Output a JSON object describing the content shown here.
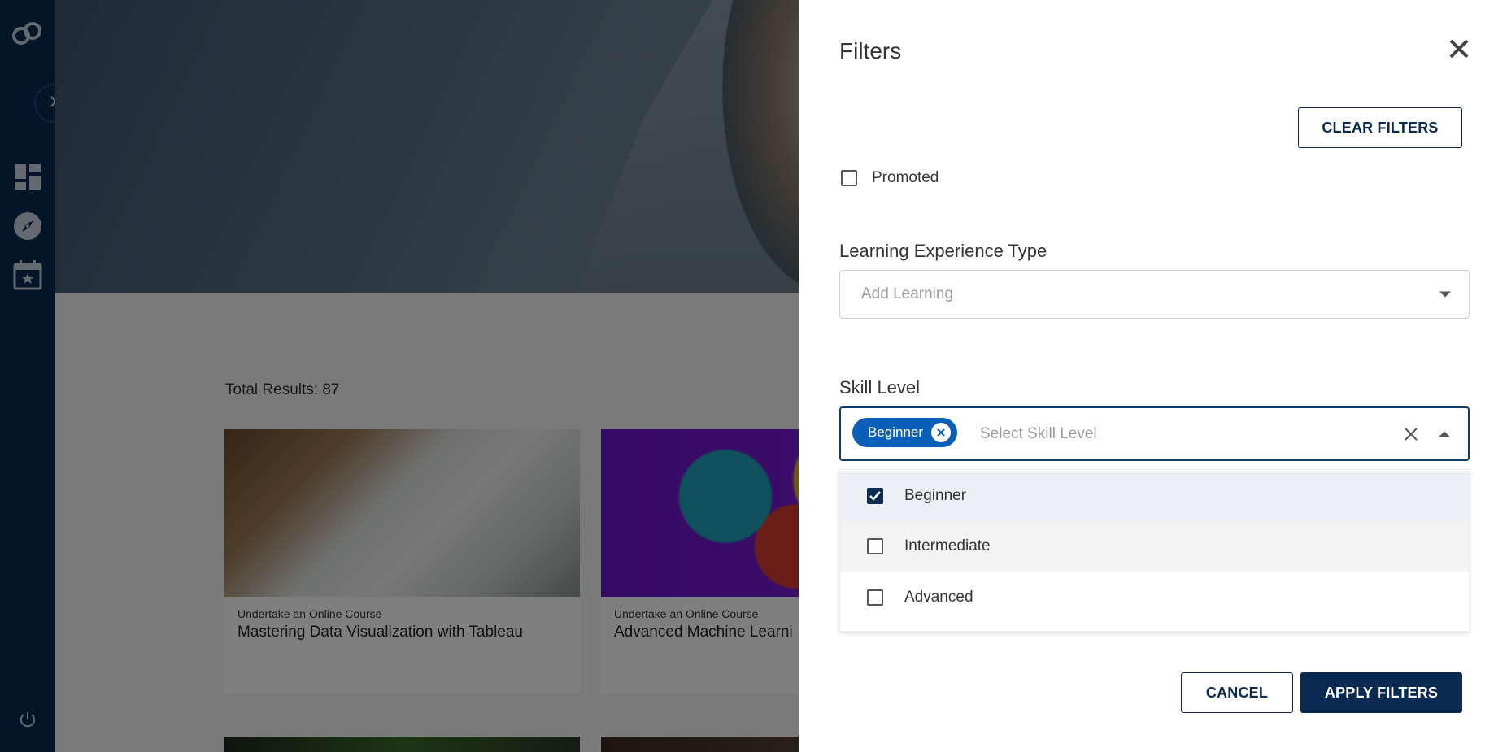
{
  "sidebar": {
    "logo": "app-logo",
    "toggle_icon": "chevron-right-icon",
    "items": [
      {
        "name": "dashboard-icon"
      },
      {
        "name": "compass-icon"
      },
      {
        "name": "calendar-star-icon"
      }
    ],
    "bottom_icon": "power-icon"
  },
  "main": {
    "total_results": "Total Results: 87",
    "cards": [
      {
        "type": "Undertake an Online Course",
        "title": "Mastering Data Visualization with Tableau"
      },
      {
        "type": "Undertake an Online Course",
        "title": "Advanced Machine Learni"
      }
    ]
  },
  "filters": {
    "title": "Filters",
    "clear_label": "CLEAR FILTERS",
    "promoted_label": "Promoted",
    "promoted_checked": false,
    "learning_type": {
      "label": "Learning Experience Type",
      "placeholder": "Add Learning"
    },
    "skill_level": {
      "label": "Skill Level",
      "placeholder": "Select Skill Level",
      "selected_chip": "Beginner",
      "options": [
        {
          "label": "Beginner",
          "checked": true
        },
        {
          "label": "Intermediate",
          "checked": false
        },
        {
          "label": "Advanced",
          "checked": false
        }
      ]
    },
    "cancel_label": "CANCEL",
    "apply_label": "APPLY FILTERS"
  },
  "colors": {
    "sidebar": "#0b2a52",
    "primary": "#0b2a52",
    "chip": "#0b5fb8",
    "highlight_row": "#eceff3",
    "hover_row": "#f3f3f3"
  }
}
